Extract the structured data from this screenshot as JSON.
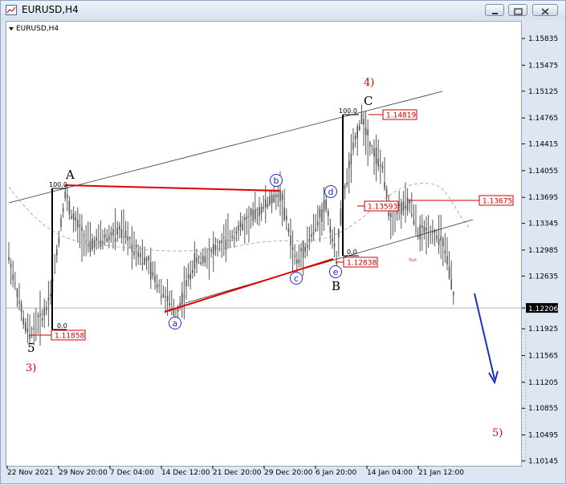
{
  "window": {
    "title": "EURUSD,H4",
    "inner_label": "EURUSD,H4",
    "buttons": [
      "minimize",
      "restore",
      "close"
    ],
    "icons": {
      "app": "chart-window-icon",
      "dropdown": "triangle-down-icon"
    }
  },
  "chart_data": {
    "type": "candlestick",
    "symbol": "EURUSD",
    "timeframe": "H4",
    "y_ticks": [
      "1.15835",
      "1.15475",
      "1.15125",
      "1.14765",
      "1.14415",
      "1.14055",
      "1.13695",
      "1.13345",
      "1.12985",
      "1.12635",
      "1.12206",
      "1.11925",
      "1.11565",
      "1.11205",
      "1.10855",
      "1.10495",
      "1.10145"
    ],
    "current_price": "1.12206",
    "ylim": [
      1.10145,
      1.16015
    ],
    "x_ticks": [
      "22 Nov 2021",
      "29 Nov 20:00",
      "7 Dec 04:00",
      "14 Dec 12:00",
      "21 Dec 20:00",
      "29 Dec 20:00",
      "6 Jan 20:00",
      "14 Jan 04:00",
      "21 Jan 12:00"
    ],
    "price_labels": [
      "1.11858",
      "1.12838",
      "1.13593",
      "1.13675",
      "1.14819"
    ],
    "fib_labels": [
      "100.0",
      "0.0",
      "100.0",
      "0.0"
    ],
    "wave_labels_black": [
      "5",
      "A",
      "B",
      "C"
    ],
    "wave_labels_red": [
      "3)",
      "4)",
      "5)"
    ],
    "wave_labels_circled": [
      "a",
      "b",
      "c",
      "d",
      "e"
    ],
    "text_label": "Text",
    "colors": {
      "bull_bear": "#555555",
      "channel": "#333333",
      "triangle": "#e00000",
      "arrow": "#1a2fc0",
      "price_box": "#cc0000",
      "circle": "#1a2fc0"
    }
  }
}
